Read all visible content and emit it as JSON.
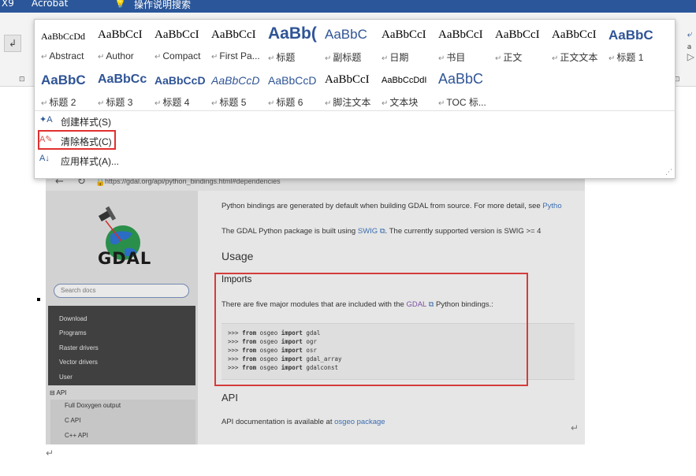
{
  "ribbon": {
    "tabs": [
      "X9",
      "Acrobat"
    ],
    "tell_me": "操作说明搜索",
    "left_button": "↲"
  },
  "styles_gallery": {
    "row1": [
      {
        "preview": "AaBbCcDd",
        "name": "Abstract"
      },
      {
        "preview": "AaBbCcI",
        "name": "Author"
      },
      {
        "preview": "AaBbCcI",
        "name": "Compact"
      },
      {
        "preview": "AaBbCcI",
        "name": "First Pa..."
      },
      {
        "preview": "AaBb(",
        "name": "标题"
      },
      {
        "preview": "AaBbC",
        "name": "副标题"
      },
      {
        "preview": "AaBbCcI",
        "name": "日期"
      },
      {
        "preview": "AaBbCcI",
        "name": "书目"
      },
      {
        "preview": "AaBbCcI",
        "name": "正文"
      },
      {
        "preview": "AaBbCcI",
        "name": "正文文本"
      },
      {
        "preview": "AaBbC",
        "name": "标题 1"
      }
    ],
    "row2": [
      {
        "preview": "AaBbC",
        "name": "标题 2"
      },
      {
        "preview": "AaBbCc",
        "name": "标题 3"
      },
      {
        "preview": "AaBbCcD",
        "name": "标题 4"
      },
      {
        "preview": "AaBbCcD",
        "name": "标题 5"
      },
      {
        "preview": "AaBbCcD",
        "name": "标题 6"
      },
      {
        "preview": "AaBbCcI",
        "name": "脚注文本"
      },
      {
        "preview": "AaBbCcDdI",
        "name": "文本块"
      },
      {
        "preview": "AaBbC",
        "name": "TOC 标..."
      }
    ],
    "menu": {
      "create": "创建样式(S)",
      "clear": "清除格式(C)",
      "apply": "应用样式(A)..."
    }
  },
  "screenshot": {
    "url": "https://gdal.org/api/python_bindings.html#dependencies",
    "logo_text": "GDAL",
    "search_placeholder": "Search docs",
    "nav": [
      "Download",
      "Programs",
      "Raster drivers",
      "Vector drivers",
      "User"
    ],
    "api_heading": "⊟ API",
    "api_children": [
      "Full Doxygen output",
      "C API",
      "C++ API"
    ],
    "content": {
      "p1_text": "Python bindings are generated by default when building GDAL from source. For more detail, see ",
      "p1_link": "Pytho",
      "p2_text": "The GDAL Python package is built using ",
      "p2_link": "SWIG",
      "p2_rest": ". The currently supported version is SWIG >= 4",
      "h_usage": "Usage",
      "h_imports": "Imports",
      "p3_text": "There are five major modules that are included with the ",
      "p3_link": "GDAL",
      "p3_rest": " Python bindings.:",
      "code": [
        {
          "prompt": ">>> ",
          "kw1": "from",
          "mod": " osgeo ",
          "kw2": "import",
          "name": " gdal"
        },
        {
          "prompt": ">>> ",
          "kw1": "from",
          "mod": " osgeo ",
          "kw2": "import",
          "name": " ogr"
        },
        {
          "prompt": ">>> ",
          "kw1": "from",
          "mod": " osgeo ",
          "kw2": "import",
          "name": " osr"
        },
        {
          "prompt": ">>> ",
          "kw1": "from",
          "mod": " osgeo ",
          "kw2": "import",
          "name": " gdal_array"
        },
        {
          "prompt": ">>> ",
          "kw1": "from",
          "mod": " osgeo ",
          "kw2": "import",
          "name": " gdalconst"
        }
      ],
      "h_api": "API",
      "p4_text": "API documentation is available at ",
      "p4_link": "osgeo package"
    }
  },
  "colors": {
    "ribbon_blue": "#2b579a",
    "heading_blue": "#2f5496",
    "highlight_red": "#e03030"
  }
}
